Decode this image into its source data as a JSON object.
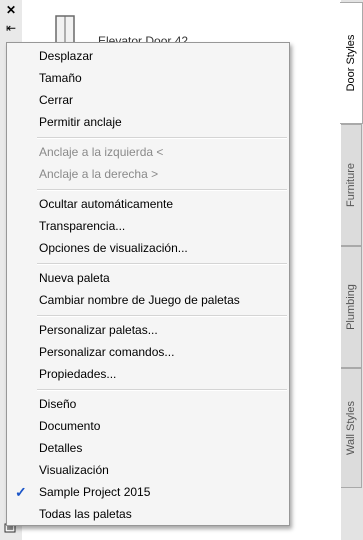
{
  "palette": {
    "tool_label": "Elevator Door 42",
    "close_glyph": "✕",
    "pin_glyph": "⇤"
  },
  "tabs": [
    {
      "label": "Door Styles",
      "active": true
    },
    {
      "label": "Furniture",
      "active": false
    },
    {
      "label": "Plumbing",
      "active": false
    },
    {
      "label": "Wall Styles",
      "active": false
    }
  ],
  "menu": {
    "group1": [
      "Desplazar",
      "Tamaño",
      "Cerrar",
      "Permitir anclaje"
    ],
    "group2": [
      "Anclaje a la izquierda  <",
      "Anclaje a la derecha  >"
    ],
    "group3": [
      "Ocultar automáticamente",
      "Transparencia...",
      "Opciones de visualización..."
    ],
    "group4": [
      "Nueva paleta",
      "Cambiar nombre de Juego de paletas"
    ],
    "group5": [
      "Personalizar paletas...",
      "Personalizar comandos...",
      "Propiedades..."
    ],
    "group6": [
      "Diseño",
      "Documento",
      "Detalles",
      "Visualización",
      "Sample Project 2015",
      "Todas las paletas"
    ],
    "checked_item": "Sample Project 2015",
    "check_glyph": "✓"
  },
  "colors": {
    "menu_bg": "#f5f5f5",
    "disabled_text": "#8a8a8a",
    "check": "#1a55c8"
  }
}
